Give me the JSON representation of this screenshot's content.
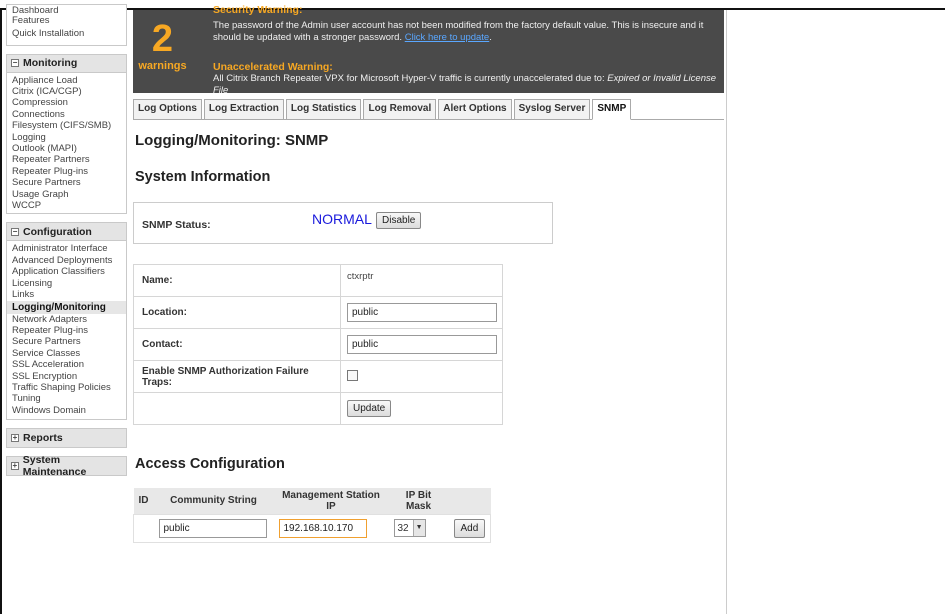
{
  "sidebar": {
    "top_items": [
      "Dashboard",
      "Features",
      "Quick Installation"
    ],
    "monitoring": {
      "title": "Monitoring",
      "items": [
        "Appliance Load",
        "Citrix (ICA/CGP)",
        "Compression",
        "Connections",
        "Filesystem (CIFS/SMB)",
        "Logging",
        "Outlook (MAPI)",
        "Repeater Partners",
        "Repeater Plug-ins",
        "Secure Partners",
        "Usage Graph",
        "WCCP"
      ]
    },
    "configuration": {
      "title": "Configuration",
      "items": [
        "Administrator Interface",
        "Advanced Deployments",
        "Application Classifiers",
        "Licensing",
        "Links",
        "Logging/Monitoring",
        "Network Adapters",
        "Repeater Plug-ins",
        "Secure Partners",
        "Service Classes",
        "SSL Acceleration",
        "SSL Encryption",
        "Traffic Shaping Policies",
        "Tuning",
        "Windows Domain"
      ]
    },
    "reports": {
      "title": "Reports"
    },
    "system_maintenance": {
      "title": "System Maintenance"
    }
  },
  "warnings": {
    "count": "2",
    "count_label": "warnings",
    "security_title": "Security Warning:",
    "security_text": "The password of the Admin user account has not been modified from the factory default value. This is insecure and it should be updated with a stronger password.",
    "security_link": "Click here to update",
    "unaccel_title": "Unaccelerated Warning:",
    "unaccel_text": "All Citrix Branch Repeater VPX for Microsoft Hyper-V traffic is currently unaccelerated due to:",
    "unaccel_reason": "Expired or Invalid License File"
  },
  "tabs": [
    "Log Options",
    "Log Extraction",
    "Log Statistics",
    "Log Removal",
    "Alert Options",
    "Syslog Server",
    "SNMP"
  ],
  "active_tab": "SNMP",
  "page_title": "Logging/Monitoring: SNMP",
  "system_info": {
    "heading": "System Information",
    "status_label": "SNMP Status:",
    "status_value": "NORMAL",
    "status_button": "Disable",
    "name_label": "Name:",
    "name_value": "ctxrptr",
    "location_label": "Location:",
    "location_value": "public",
    "contact_label": "Contact:",
    "contact_value": "public",
    "traps_label": "Enable SNMP Authorization Failure Traps:",
    "update_button": "Update"
  },
  "access_config": {
    "heading": "Access Configuration",
    "columns": [
      "ID",
      "Community String",
      "Management Station IP",
      "IP Bit Mask"
    ],
    "community_value": "public",
    "station_ip_value": "192.168.10.170",
    "bitmask_value": "32",
    "add_button": "Add"
  },
  "colors": {
    "warning_accent": "#f7a823",
    "status_normal": "#1a1adc"
  }
}
